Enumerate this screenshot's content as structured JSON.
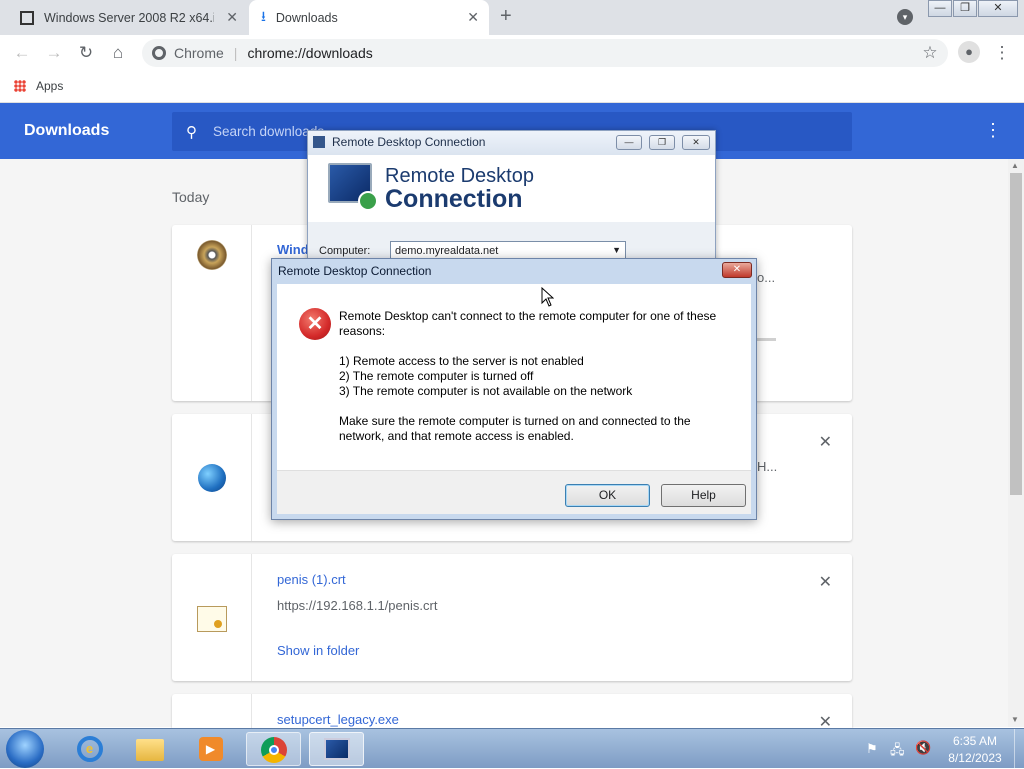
{
  "browser": {
    "tabs": [
      {
        "title": "Windows Server 2008 R2 x64.iso",
        "close": "✕"
      },
      {
        "title": "Downloads",
        "close": "✕"
      }
    ],
    "new_tab": "+",
    "win_controls": [
      "—",
      "❐",
      "✕"
    ],
    "address": {
      "site": "Chrome",
      "url": "chrome://downloads"
    },
    "bookmarks_apps": "Apps"
  },
  "downloads": {
    "title": "Downloads",
    "search_placeholder": "Search downloads",
    "section": "Today",
    "items": [
      {
        "name": "Wind",
        "url": "",
        "link": ""
      },
      {
        "name": "",
        "url": "",
        "link": ""
      },
      {
        "name": "penis (1).crt",
        "url": "https://192.168.1.1/penis.crt",
        "link": "Show in folder"
      },
      {
        "name": "setupcert_legacy.exe",
        "url": "",
        "link": ""
      }
    ],
    "partial_texts": [
      "o...",
      "H..."
    ]
  },
  "rdc_window": {
    "title": "Remote Desktop Connection",
    "brand_line1": "Remote Desktop",
    "brand_line2": "Connection",
    "computer_label": "Computer:",
    "computer_value": "demo.myrealdata.net"
  },
  "error_dialog": {
    "title": "Remote Desktop Connection",
    "message_intro": "Remote Desktop can't connect to the remote computer for one of these reasons:",
    "reasons": [
      "1) Remote access to the server is not enabled",
      "2) The remote computer is turned off",
      "3) The remote computer is not available on the network"
    ],
    "message_outro": "Make sure the remote computer is turned on and connected to the network, and that remote access is enabled.",
    "ok_label": "OK",
    "help_label": "Help"
  },
  "taskbar": {
    "time": "6:35 AM",
    "date": "8/12/2023"
  },
  "colors": {
    "chrome_blue": "#3367d6",
    "link": "#3367d6",
    "error_red": "#d42a2a"
  }
}
